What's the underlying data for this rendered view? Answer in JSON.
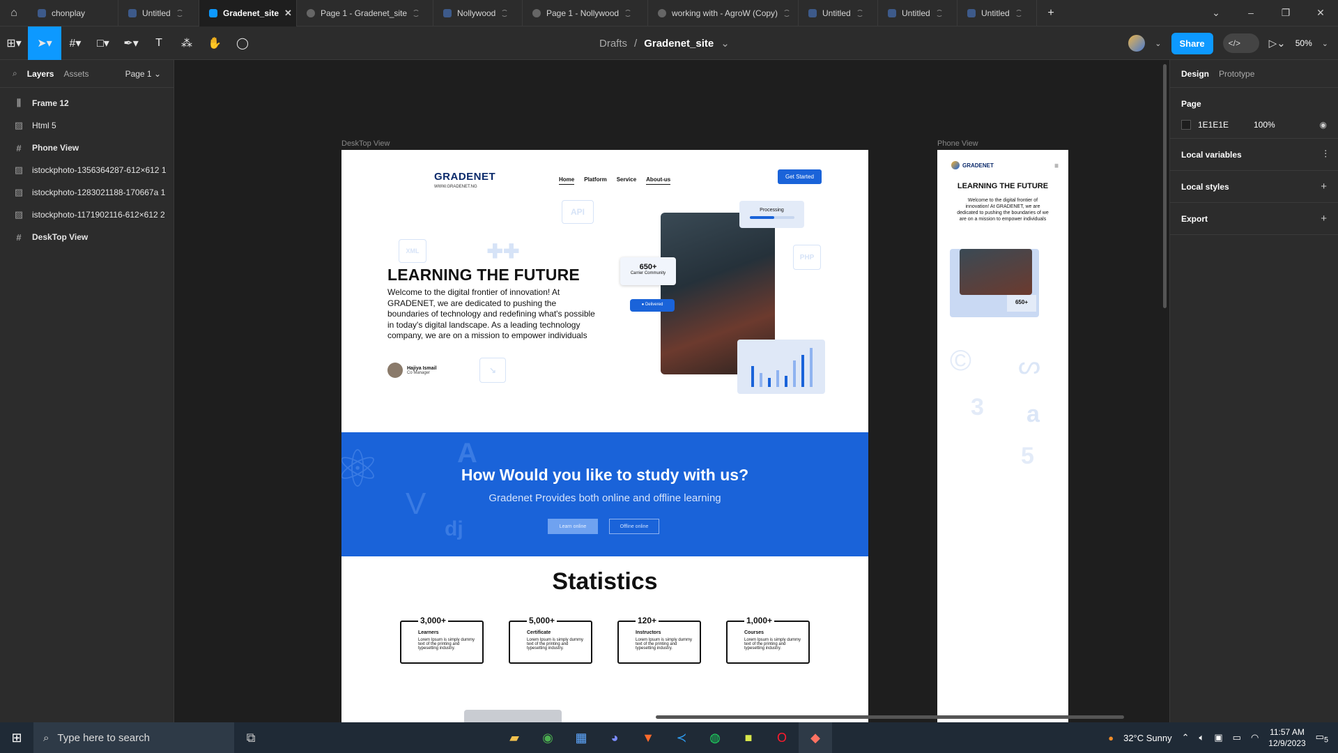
{
  "tabs": [
    {
      "label": "chonplay",
      "active": false
    },
    {
      "label": "Untitled",
      "active": false
    },
    {
      "label": "Gradenet_site",
      "active": true
    },
    {
      "label": "Page 1 - Gradenet_site",
      "active": false
    },
    {
      "label": "Nollywood",
      "active": false
    },
    {
      "label": "Page 1 - Nollywood",
      "active": false
    },
    {
      "label": "working with - AgroW (Copy)",
      "active": false
    },
    {
      "label": "Untitled",
      "active": false
    },
    {
      "label": "Untitled",
      "active": false
    },
    {
      "label": "Untitled",
      "active": false
    }
  ],
  "breadcrumb": {
    "folder": "Drafts",
    "separator": "/",
    "file": "Gradenet_site"
  },
  "toolbar": {
    "share_label": "Share",
    "zoom": "50%"
  },
  "left_panel": {
    "tabs": {
      "layers": "Layers",
      "assets": "Assets"
    },
    "page_selector": "Page 1",
    "layers": [
      {
        "icon": "frame-icon",
        "label": "Frame 12",
        "bold": true
      },
      {
        "icon": "image-icon",
        "label": "Html 5",
        "bold": false
      },
      {
        "icon": "hash-icon",
        "label": "Phone View",
        "bold": true
      },
      {
        "icon": "image-icon",
        "label": "istockphoto-1356364287-612×612 1",
        "bold": false
      },
      {
        "icon": "image-icon",
        "label": "istockphoto-1283021188-170667a 1",
        "bold": false
      },
      {
        "icon": "image-icon",
        "label": "istockphoto-1171902116-612×612 2",
        "bold": false
      },
      {
        "icon": "hash-icon",
        "label": "DeskTop View",
        "bold": true
      }
    ]
  },
  "right_panel": {
    "tabs": {
      "design": "Design",
      "prototype": "Prototype"
    },
    "page_title": "Page",
    "page_color": "1E1E1E",
    "page_opacity": "100%",
    "sections": [
      "Local variables",
      "Local styles",
      "Export"
    ]
  },
  "canvas": {
    "desktop_label": "DeskTop View",
    "phone_label": "Phone View"
  },
  "desktop": {
    "logo": "GRADENET",
    "logo_sub": "WWW.GRADENET.NG",
    "nav": [
      "Home",
      "Platform",
      "Service",
      "About-us"
    ],
    "cta": "Get Started",
    "hero_title": "LEARNING THE FUTURE",
    "hero_text": "Welcome to the digital frontier of innovation! At GRADENET, we are dedicated to pushing the boundaries of technology and redefining what's possible in today's digital landscape. As a leading technology company, we are on a mission to empower individuals",
    "author_name": "Hajiya Ismail",
    "author_role": "Co Manager",
    "card_processing": "Processing",
    "card_count": "650+",
    "card_count_label": "Carrier Community",
    "card_delivered": "Delivered",
    "ghost_api": "API",
    "ghost_xml": "XML",
    "ghost_php": "PHP",
    "study_title": "How Would you like to study with us?",
    "study_sub": "Gradenet Provides both online and offline learning",
    "btn_online": "Learn online",
    "btn_offline": "Offline online",
    "stats_title": "Statistics",
    "stats": [
      {
        "value": "3,000+",
        "label": "Learners",
        "text": "Lorem Ipsum is simply dummy text of the printing and typesetting industry."
      },
      {
        "value": "5,000+",
        "label": "Certificate",
        "text": "Lorem Ipsum is simply dummy text of the printing and typesetting industry."
      },
      {
        "value": "120+",
        "label": "Instructors",
        "text": "Lorem Ipsum is simply dummy text of the printing and typesetting industry."
      },
      {
        "value": "1,000+",
        "label": "Courses",
        "text": "Lorem Ipsum is simply dummy text of the printing and typesetting industry."
      }
    ]
  },
  "phone": {
    "logo": "GRADENET",
    "title": "LEARNING THE FUTURE",
    "text": "Welcome to the digital frontier of innovation! At GRADENET, we are dedicated to pushing the boundaries of we are on a mission to empower individuals",
    "card_count": "650+"
  },
  "taskbar": {
    "search_placeholder": "Type here to search",
    "weather": "32°C  Sunny",
    "time": "11:57 AM",
    "date": "12/9/2023",
    "notifications": "5"
  }
}
